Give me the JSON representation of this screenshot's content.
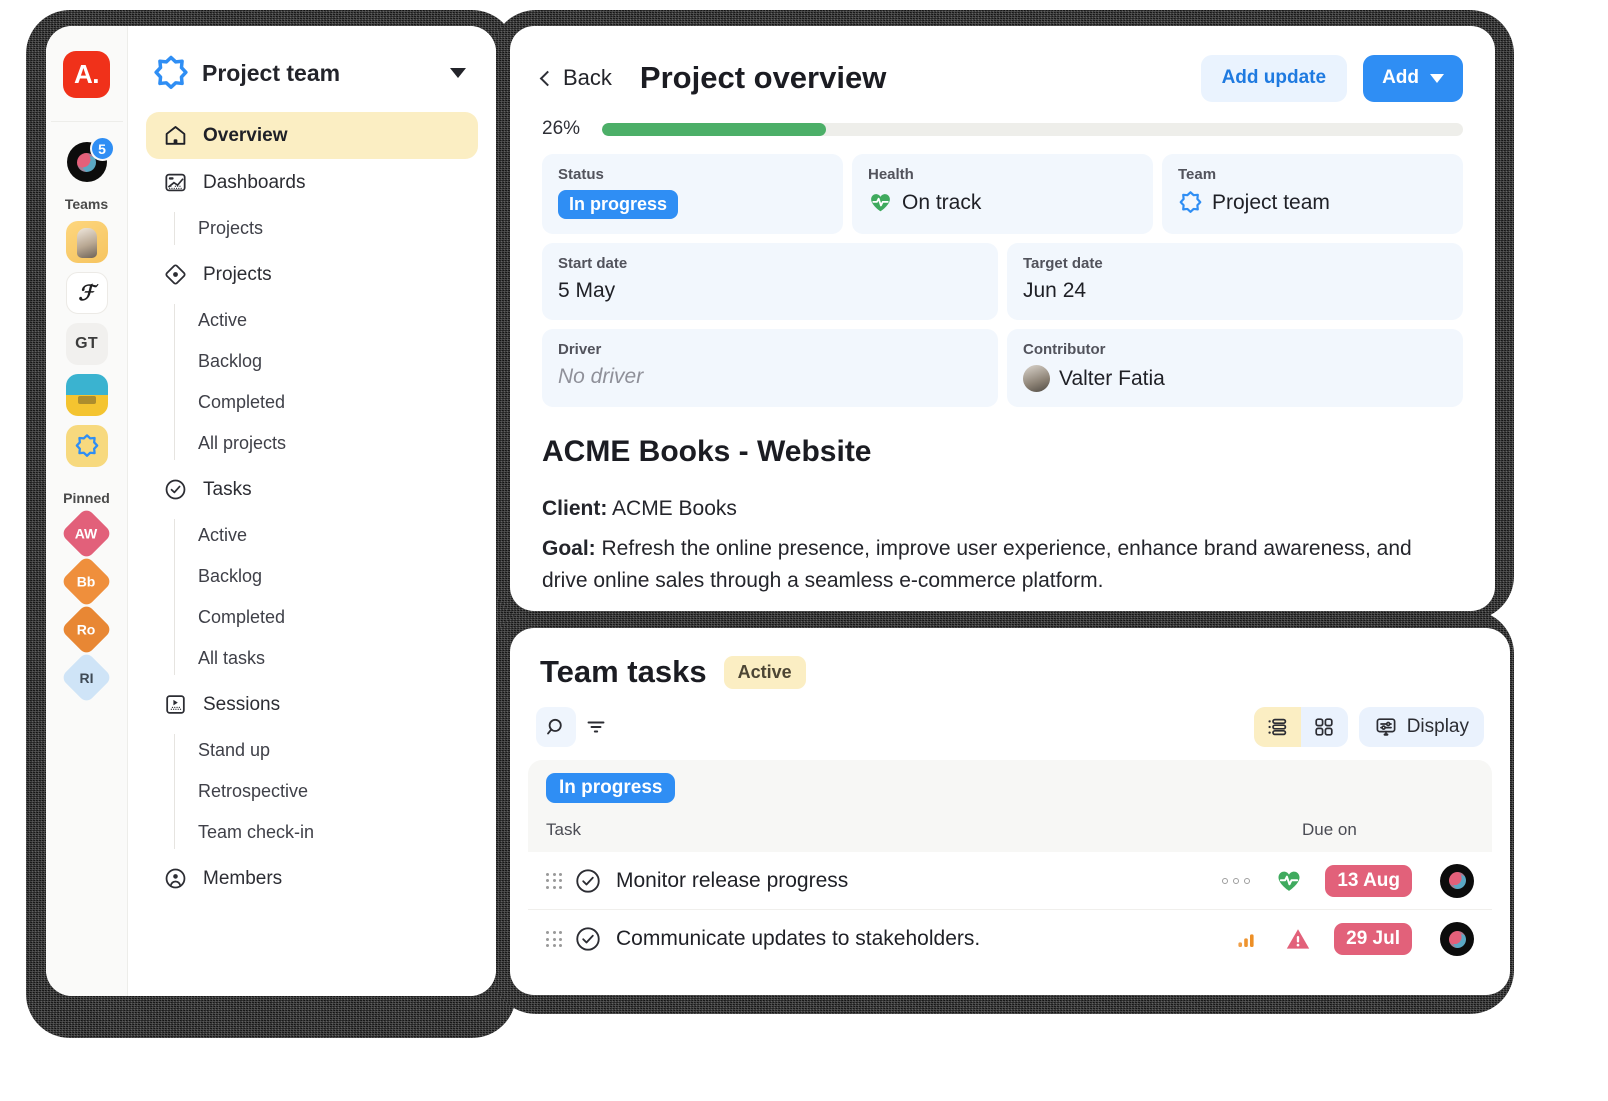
{
  "rail": {
    "app_logo_label": "A.",
    "user_badge_count": "5",
    "teams_label": "Teams",
    "team_tiles": [
      {
        "name": "dog-photo-team",
        "label": ""
      },
      {
        "name": "f-serif-team",
        "label": "ℱ"
      },
      {
        "name": "gt-team",
        "label": "GT"
      },
      {
        "name": "ukraine-team",
        "label": ""
      },
      {
        "name": "project-team",
        "label": ""
      }
    ],
    "pinned_label": "Pinned",
    "pinned_tiles": [
      {
        "label": "AW"
      },
      {
        "label": "Bb"
      },
      {
        "label": "Ro"
      },
      {
        "label": "RI"
      }
    ]
  },
  "sidebar": {
    "workspace_title": "Project team",
    "items": [
      {
        "label": "Overview",
        "icon": "home-icon",
        "active": true
      },
      {
        "label": "Dashboards",
        "icon": "dashboard-icon",
        "active": false
      },
      {
        "label": "Projects",
        "icon": "target-icon",
        "active": false
      },
      {
        "label": "Tasks",
        "icon": "check-icon",
        "active": false
      },
      {
        "label": "Sessions",
        "icon": "sessions-icon",
        "active": false
      },
      {
        "label": "Members",
        "icon": "member-icon",
        "active": false
      }
    ],
    "dashboards_children": [
      "Projects"
    ],
    "projects_children": [
      "Active",
      "Backlog",
      "Completed",
      "All projects"
    ],
    "tasks_children": [
      "Active",
      "Backlog",
      "Completed",
      "All tasks"
    ],
    "sessions_children": [
      "Stand up",
      "Retrospective",
      "Team check-in"
    ]
  },
  "overview": {
    "back_label": "Back",
    "title": "Project overview",
    "add_update_label": "Add update",
    "add_label": "Add",
    "progress_percent_label": "26%",
    "progress_percent_value": 26,
    "meta": [
      {
        "label": "Status",
        "value": "In progress",
        "kind": "chip"
      },
      {
        "label": "Health",
        "value": "On track",
        "kind": "health"
      },
      {
        "label": "Team",
        "value": "Project team",
        "kind": "team"
      },
      {
        "label": "Start date",
        "value": "5 May",
        "kind": "text"
      },
      {
        "label": "Target date",
        "value": "Jun 24",
        "kind": "text"
      },
      {
        "label": "Driver",
        "value": "No driver",
        "kind": "empty"
      },
      {
        "label": "Contributor",
        "value": "Valter Fatia",
        "kind": "person"
      }
    ],
    "project_title": "ACME Books - Website",
    "client_label": "Client:",
    "client_value": "ACME Books",
    "goal_label": "Goal:",
    "goal_value": "Refresh the online presence, improve user experience, enhance brand awareness, and drive online sales through a seamless e-commerce platform."
  },
  "tasks": {
    "title": "Team tasks",
    "filter_chip": "Active",
    "display_label": "Display",
    "group_label": "In progress",
    "columns": {
      "task": "Task",
      "due": "Due on"
    },
    "rows": [
      {
        "name": "Monitor release progress",
        "due": "13 Aug",
        "signal": "heartbeat-icon",
        "show_more_dots": true
      },
      {
        "name": "Communicate updates to stakeholders.",
        "due": "29 Jul",
        "signal": "warning-icon",
        "priority": "priority-bars-icon",
        "show_more_dots": false
      }
    ]
  },
  "colors": {
    "accent_blue": "#2f8ef4",
    "logo_red": "#f0311a",
    "highlight_yellow": "#fbeec3",
    "progress_green": "#4caf68",
    "due_red": "#e2617a",
    "card_blue": "#f2f7fd"
  }
}
